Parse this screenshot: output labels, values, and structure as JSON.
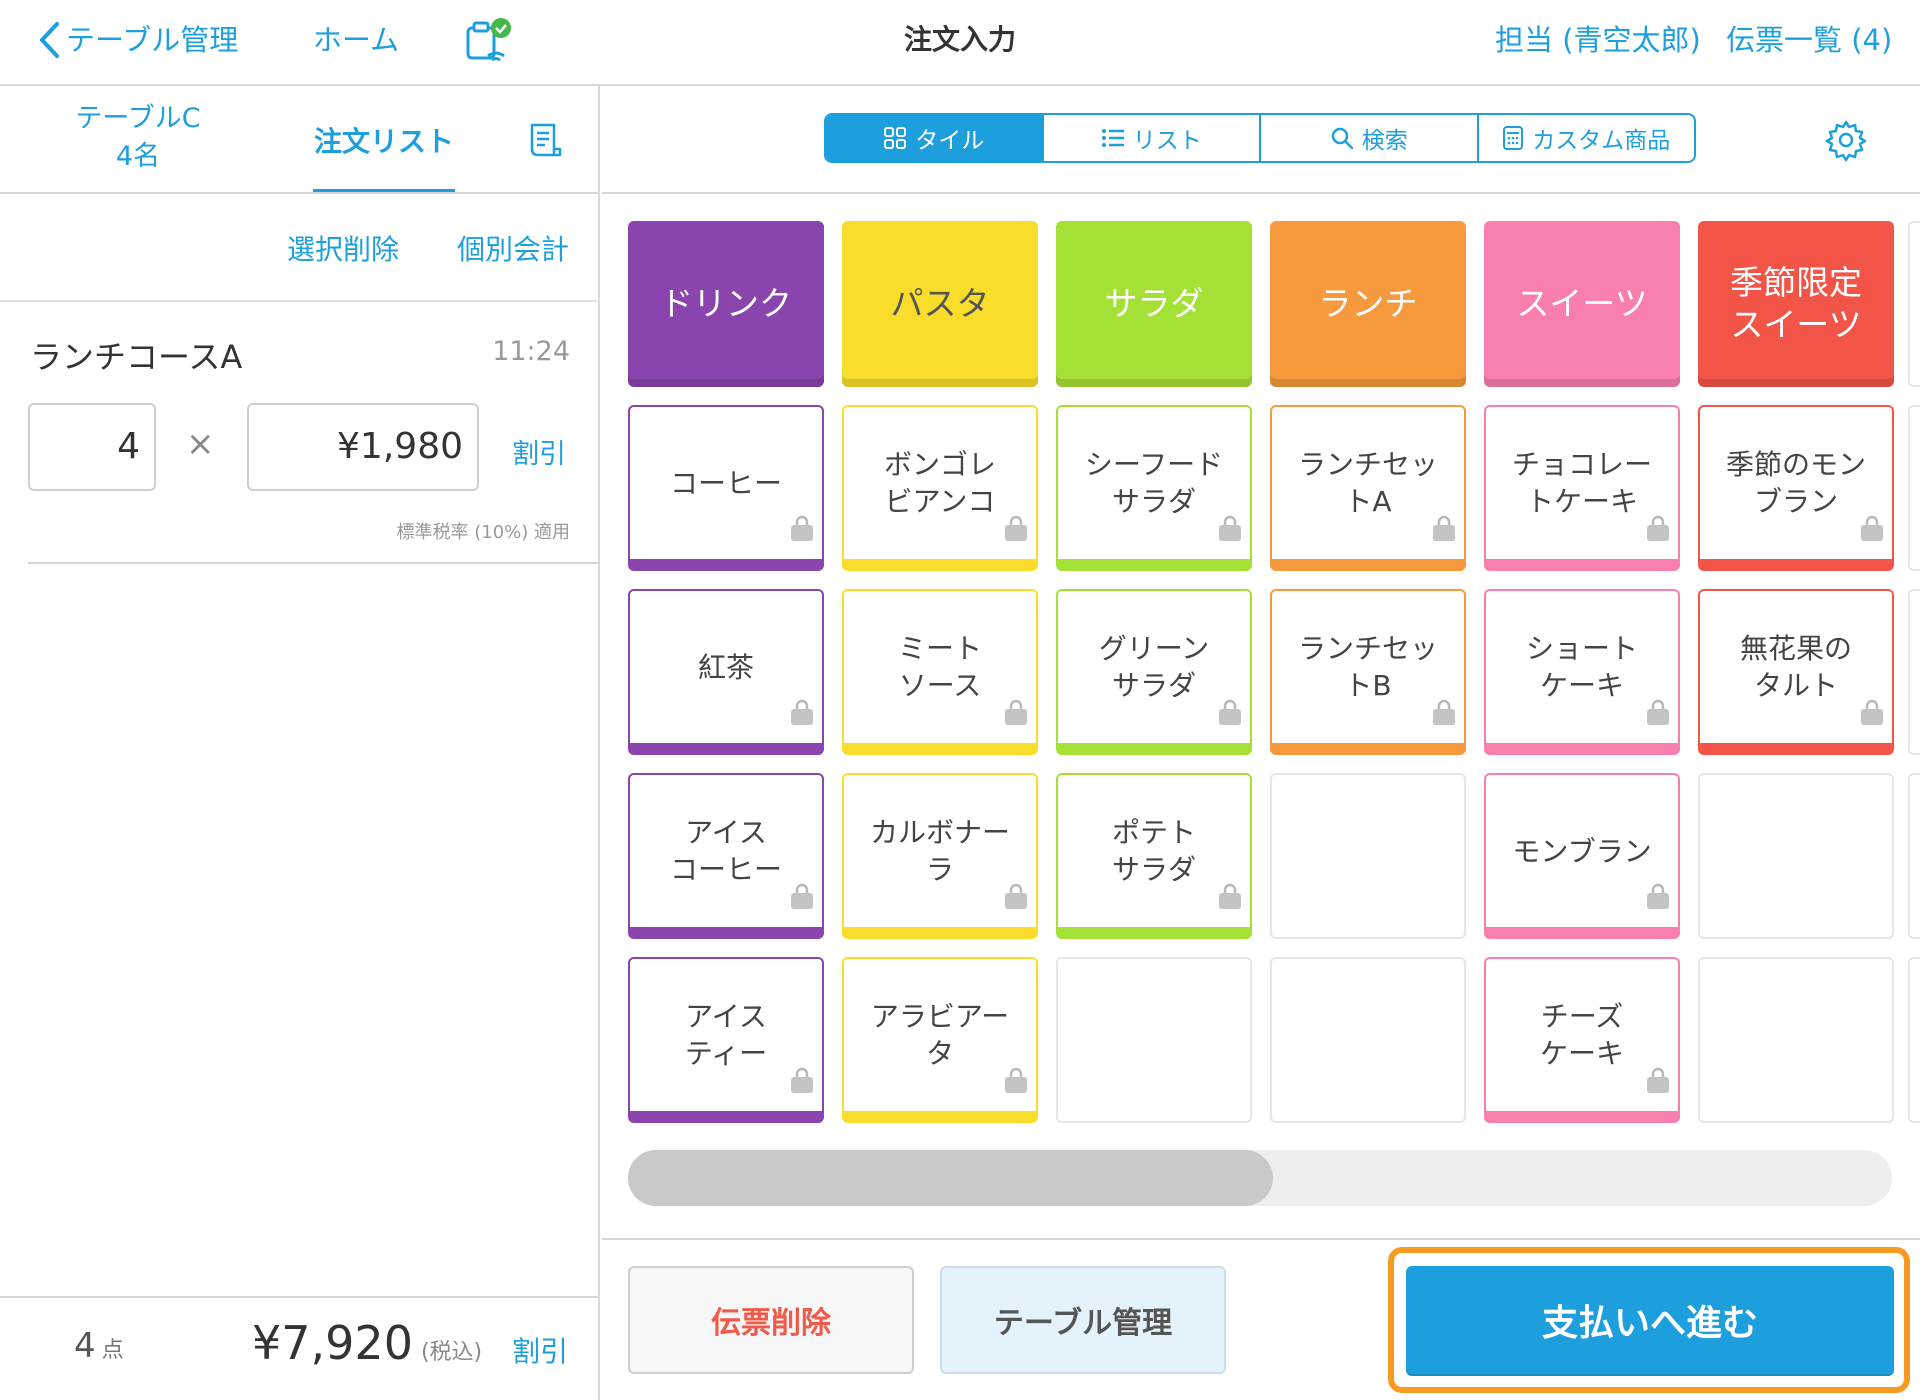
{
  "header": {
    "back_label": "テーブル管理",
    "home_label": "ホーム",
    "title": "注文入力",
    "staff_label": "担当 (青空太郎)",
    "slips_label": "伝票一覧 (4)"
  },
  "left": {
    "table_name": "テーブルC",
    "guests": "4名",
    "order_list_tab": "注文リスト",
    "select_delete": "選択削除",
    "split_pay": "個別会計",
    "item": {
      "name": "ランチコースA",
      "time": "11:24",
      "quantity": "4",
      "times": "×",
      "price": "¥1,980",
      "discount": "割引",
      "tax_note": "標準税率 (10%) 適用"
    },
    "footer": {
      "count": "4",
      "count_unit": "点",
      "total": "¥7,920",
      "tax_incl": "(税込)",
      "discount": "割引"
    }
  },
  "view_modes": {
    "tile": "タイル",
    "list": "リスト",
    "search": "検索",
    "custom": "カスタム商品",
    "active": "tile"
  },
  "categories": [
    {
      "name": "ドリンク",
      "color": "#8a44ad",
      "products": [
        "コーヒー",
        "紅茶",
        "アイス\nコーヒー",
        "アイス\nティー"
      ]
    },
    {
      "name": "パスタ",
      "color": "#f9dd2b",
      "products": [
        "ボンゴレ\nビアンコ",
        "ミート\nソース",
        "カルボナー\nラ",
        "アラビアー\nタ"
      ]
    },
    {
      "name": "サラダ",
      "color": "#a5e036",
      "products": [
        "シーフード\nサラダ",
        "グリーン\nサラダ",
        "ポテト\nサラダ"
      ]
    },
    {
      "name": "ランチ",
      "color": "#f69a3d",
      "products": [
        "ランチセッ\nトA",
        "ランチセッ\nトB"
      ]
    },
    {
      "name": "スイーツ",
      "color": "#f87fb0",
      "products": [
        "チョコレー\nトケーキ",
        "ショート\nケーキ",
        "モンブラン",
        "チーズ\nケーキ"
      ]
    },
    {
      "name": "季節限定\nスイーツ",
      "color": "#f25548",
      "products": [
        "季節のモン\nブラン",
        "無花果の\nタルト"
      ]
    }
  ],
  "scroll_fraction": 0.51,
  "buttons": {
    "delete_slip": "伝票削除",
    "table_management": "テーブル管理",
    "proceed_payment": "支払いへ進む"
  }
}
